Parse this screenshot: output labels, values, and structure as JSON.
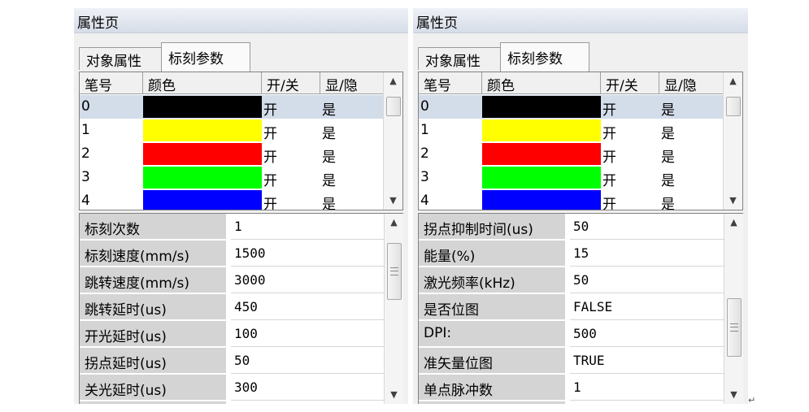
{
  "left_panel": {
    "title": "属性页",
    "tabs": [
      {
        "label": "对象属性",
        "active": false
      },
      {
        "label": "标刻参数",
        "active": true
      }
    ],
    "grid": {
      "headers": [
        "笔号",
        "颜色",
        "开/关",
        "显/隐"
      ],
      "rows": [
        {
          "pen": "0",
          "color": "#000000",
          "on_off": "开",
          "show_hide": "是",
          "selected": true
        },
        {
          "pen": "1",
          "color": "#ffff00",
          "on_off": "开",
          "show_hide": "是",
          "selected": false
        },
        {
          "pen": "2",
          "color": "#ff0000",
          "on_off": "开",
          "show_hide": "是",
          "selected": false
        },
        {
          "pen": "3",
          "color": "#00ff00",
          "on_off": "开",
          "show_hide": "是",
          "selected": false
        },
        {
          "pen": "4",
          "color": "#0000ff",
          "on_off": "开",
          "show_hide": "是",
          "selected": false
        }
      ]
    },
    "properties": [
      {
        "name": "标刻次数",
        "value": "1"
      },
      {
        "name": "标刻速度(mm/s)",
        "value": "1500"
      },
      {
        "name": "跳转速度(mm/s)",
        "value": "3000"
      },
      {
        "name": "跳转延时(us)",
        "value": "450"
      },
      {
        "name": "开光延时(us)",
        "value": "100"
      },
      {
        "name": "拐点延时(us)",
        "value": "50"
      },
      {
        "name": "关光延时(us)",
        "value": "300"
      }
    ]
  },
  "right_panel": {
    "title": "属性页",
    "tabs": [
      {
        "label": "对象属性",
        "active": false
      },
      {
        "label": "标刻参数",
        "active": true
      }
    ],
    "grid": {
      "headers": [
        "笔号",
        "颜色",
        "开/关",
        "显/隐"
      ],
      "rows": [
        {
          "pen": "0",
          "color": "#000000",
          "on_off": "开",
          "show_hide": "是",
          "selected": true
        },
        {
          "pen": "1",
          "color": "#ffff00",
          "on_off": "开",
          "show_hide": "是",
          "selected": false
        },
        {
          "pen": "2",
          "color": "#ff0000",
          "on_off": "开",
          "show_hide": "是",
          "selected": false
        },
        {
          "pen": "3",
          "color": "#00ff00",
          "on_off": "开",
          "show_hide": "是",
          "selected": false
        },
        {
          "pen": "4",
          "color": "#0000ff",
          "on_off": "开",
          "show_hide": "是",
          "selected": false
        }
      ]
    },
    "properties": [
      {
        "name": "拐点抑制时间(us)",
        "value": "50"
      },
      {
        "name": "能量(%)",
        "value": "15"
      },
      {
        "name": "激光频率(kHz)",
        "value": "50"
      },
      {
        "name": "是否位图",
        "value": "FALSE"
      },
      {
        "name": "DPI:",
        "value": "500"
      },
      {
        "name": "准矢量位图",
        "value": "TRUE"
      },
      {
        "name": "单点脉冲数",
        "value": "1"
      }
    ]
  },
  "icons": {
    "scroll_up": "▲",
    "scroll_down": "▼"
  },
  "colors": {
    "selected_row": "#d3dce9",
    "property_name_bg": "#d4d4d4",
    "panel_bg": "#f0f0f0"
  },
  "return_mark": "↵"
}
